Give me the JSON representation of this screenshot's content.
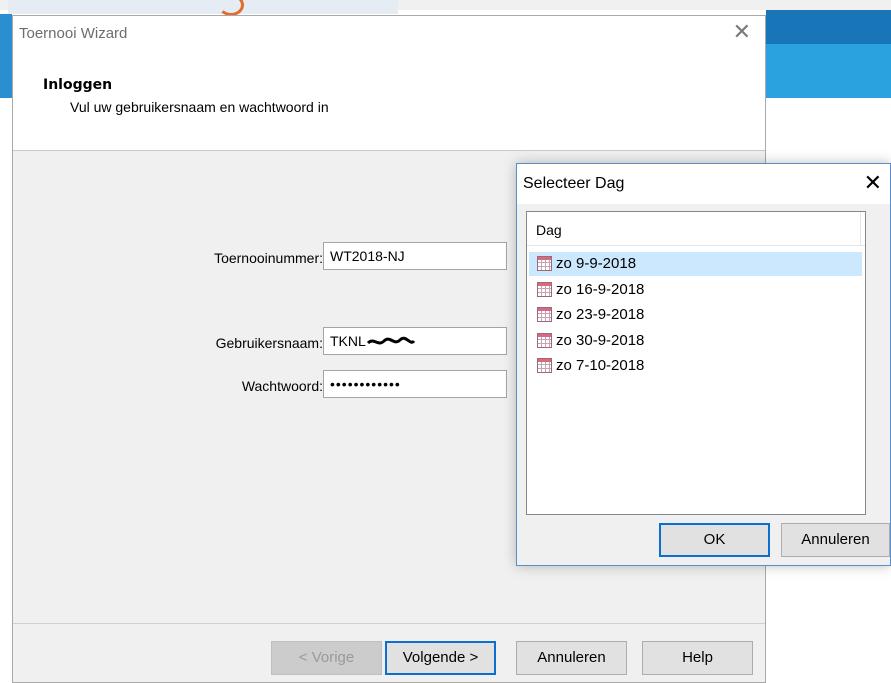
{
  "wizard": {
    "title": "Toernooi Wizard",
    "heading": "Inloggen",
    "subheading": "Vul uw gebruikersnaam en wachtwoord in",
    "fields": {
      "tournament_label": "Toernooinummer:",
      "tournament_value": "WT2018-NJ",
      "username_label": "Gebruikersnaam:",
      "username_value": "TKNL",
      "password_label": "Wachtwoord:",
      "password_value": "••••••••••••"
    },
    "buttons": {
      "back": "< Vorige",
      "next": "Volgende >",
      "cancel": "Annuleren",
      "help": "Help"
    }
  },
  "dialog": {
    "title": "Selecteer Dag",
    "column_header": "Dag",
    "items": [
      {
        "label": "zo 9-9-2018",
        "selected": true
      },
      {
        "label": "zo 16-9-2018",
        "selected": false
      },
      {
        "label": "zo 23-9-2018",
        "selected": false
      },
      {
        "label": "zo 30-9-2018",
        "selected": false
      },
      {
        "label": "zo 7-10-2018",
        "selected": false
      }
    ],
    "ok_label": "OK",
    "cancel_label": "Annuleren"
  },
  "colors": {
    "accent": "#0a6fd1",
    "selection": "#cce8ff",
    "background_app_blue": "#1775b8"
  },
  "icons": [
    "close-icon",
    "calendar-icon"
  ]
}
